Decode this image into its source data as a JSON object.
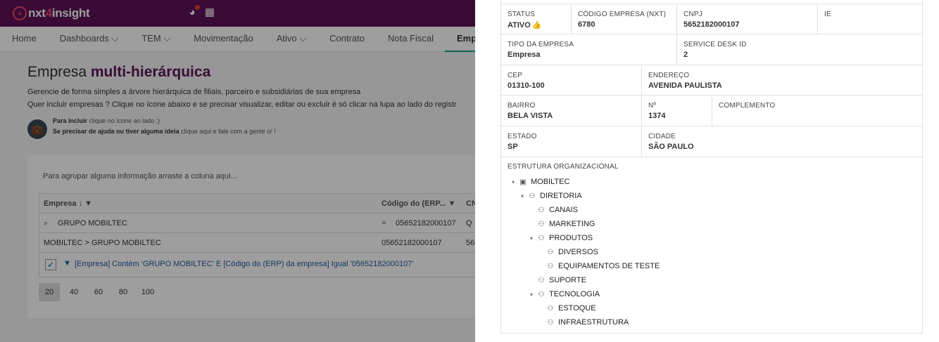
{
  "app": {
    "logo_prefix": "nxt",
    "logo_mid": "4",
    "logo_suffix": "insight",
    "icons": [
      "globe-icon",
      "grid-apps-icon"
    ]
  },
  "nav": {
    "items": [
      "Home",
      "Dashboards ⌵",
      "TEM ⌵",
      "Movimentação",
      "Ativo ⌵",
      "Contrato",
      "Nota Fiscal",
      "Empresa"
    ],
    "active": "Empresa"
  },
  "page": {
    "title_plain": "Empresa",
    "title_bold": "multi-hierárquica",
    "desc1": "Gerencie de forma simples a árvore hierárquica de filiais, parceiro e subsidiárias de sua empresa",
    "desc2": "Quer incluir empresas ? Clique no ícone abaixo e se precisar visualizar, editar ou excluir é só clicar na lupa ao lado do registr",
    "help1_bold": "Para incluir",
    "help1_text": "clique no ícone ao lado ;)",
    "help2_bold": "Se precisar de ajuda ou tiver alguma ideia",
    "help2_text": "clique aqui e fale com a gente o/ !"
  },
  "grid": {
    "group_hint": "Para agrupar alguma informação arraste a coluna aqui...",
    "columns": [
      "Empresa ↓",
      "Código do (ERP...",
      "CN"
    ],
    "filter_values": [
      "GRUPO MOBILTEC",
      "=",
      "05652182000107",
      "Q"
    ],
    "rows": [
      [
        "MOBILTEC > GRUPO MOBILTEC",
        "05652182000107",
        "56"
      ]
    ],
    "active_filter": "[Empresa] Contém 'GRUPO MOBILTEC' E [Código do (ERP) da empresa] Igual '05652182000107'",
    "page_sizes": [
      "20",
      "40",
      "60",
      "80",
      "100"
    ],
    "active_page_size": "20"
  },
  "detail": {
    "status_label": "STATUS",
    "status_value": "ATIVO",
    "codigo_label": "CÓDIGO EMPRESA (NXT)",
    "codigo_value": "6780",
    "cnpj_label": "CNPJ",
    "cnpj_value": "5652182000107",
    "ie_label": "IE",
    "ie_value": "",
    "tipo_label": "TIPO DA EMPRESA",
    "tipo_value": "Empresa",
    "sd_label": "SERVICE DESK ID",
    "sd_value": "2",
    "cep_label": "CEP",
    "cep_value": "01310-100",
    "endereco_label": "ENDEREÇO",
    "endereco_value": "AVENIDA PAULISTA",
    "bairro_label": "BAIRRO",
    "bairro_value": "BELA VISTA",
    "numero_label": "Nº",
    "numero_value": "1374",
    "complemento_label": "COMPLEMENTO",
    "complemento_value": "",
    "estado_label": "ESTADO",
    "estado_value": "SP",
    "cidade_label": "CIDADE",
    "cidade_value": "SÃO PAULO",
    "tree_title": "ESTRUTURA ORGANIZACIONAL",
    "tree": [
      {
        "label": "MOBILTEC",
        "level": 0,
        "expanded": true,
        "icon": "building-icon"
      },
      {
        "label": "DIRETORIA",
        "level": 1,
        "expanded": true,
        "icon": "org-chart-icon"
      },
      {
        "label": "CANAIS",
        "level": 2,
        "expanded": false,
        "icon": "org-chart-icon"
      },
      {
        "label": "MARKETING",
        "level": 2,
        "expanded": false,
        "icon": "org-chart-icon"
      },
      {
        "label": "PRODUTOS",
        "level": 2,
        "expanded": true,
        "icon": "org-chart-icon"
      },
      {
        "label": "DIVERSOS",
        "level": 3,
        "expanded": false,
        "icon": "org-chart-icon"
      },
      {
        "label": "EQUIPAMENTOS DE TESTE",
        "level": 3,
        "expanded": false,
        "icon": "org-chart-icon"
      },
      {
        "label": "SUPORTE",
        "level": 2,
        "expanded": false,
        "icon": "org-chart-icon"
      },
      {
        "label": "TECNOLOGIA",
        "level": 2,
        "expanded": true,
        "icon": "org-chart-icon"
      },
      {
        "label": "ESTOQUE",
        "level": 3,
        "expanded": false,
        "icon": "org-chart-icon"
      },
      {
        "label": "INFRAESTRUTURA",
        "level": 3,
        "expanded": false,
        "icon": "org-chart-icon"
      }
    ]
  }
}
